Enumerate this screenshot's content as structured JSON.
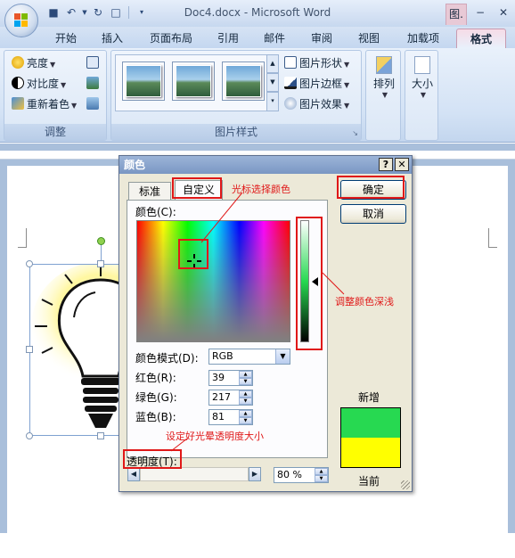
{
  "window": {
    "title": "Doc4.docx - Microsoft Word",
    "context_tab_short": "图.",
    "minimize": "−",
    "close": "✕"
  },
  "ribbon_tabs": [
    "开始",
    "插入",
    "页面布局",
    "引用",
    "邮件",
    "审阅",
    "视图",
    "加载项",
    "格式"
  ],
  "adjust_group": {
    "label": "调整",
    "brightness": "亮度",
    "contrast": "对比度",
    "recolor": "重新着色"
  },
  "picture_styles_group": {
    "label": "图片样式",
    "shape": "图片形状",
    "border": "图片边框",
    "effects": "图片效果"
  },
  "arrange": {
    "label": "排列"
  },
  "size": {
    "label": "大小"
  },
  "dialog": {
    "title": "颜色",
    "help": "?",
    "close": "✕",
    "tab_standard": "标准",
    "tab_custom": "自定义",
    "colors_label": "颜色(C):",
    "mode_label": "颜色模式(D):",
    "mode_value": "RGB",
    "red_label": "红色(R):",
    "red_value": "39",
    "green_label": "绿色(G):",
    "green_value": "217",
    "blue_label": "蓝色(B):",
    "blue_value": "81",
    "transparency_label": "透明度(T):",
    "transparency_value": "80 %",
    "transparency_level": 0.8,
    "ok": "确定",
    "cancel": "取消",
    "new_label": "新增",
    "current_label": "当前",
    "new_color": "#27d951",
    "current_color": "#ffff00"
  },
  "annotations": {
    "pick_color": "光标选择颜色",
    "adjust_depth": "调整颜色深浅",
    "set_transparency": "设定好光晕透明度大小"
  },
  "colors": {
    "annotation_red": "#e01818",
    "ribbon_blue": "#d3e2f5",
    "dialog_bg": "#ece9d8"
  }
}
